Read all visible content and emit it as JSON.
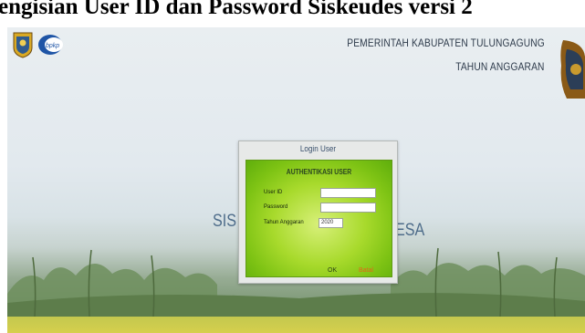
{
  "caption": {
    "text": "engisian User ID dan Password Siskeudes versi 2"
  },
  "header": {
    "line1": "PEMERINTAH KABUPATEN TULUNGAGUNG",
    "line2": "TAHUN ANGGARAN",
    "bpkp_logo_text": "bpkp"
  },
  "background": {
    "sis_left": "SIS",
    "sis_right": "ESA"
  },
  "dialog": {
    "title": "Login User",
    "panel_title": "AUTHENTIKASI USER",
    "user_id_label": "User ID",
    "user_id_value": "",
    "password_label": "Password",
    "password_value": "",
    "tahun_label": "Tahun Anggaran",
    "tahun_value": "2020",
    "ok_label": "OK",
    "batal_label": "Batal"
  }
}
